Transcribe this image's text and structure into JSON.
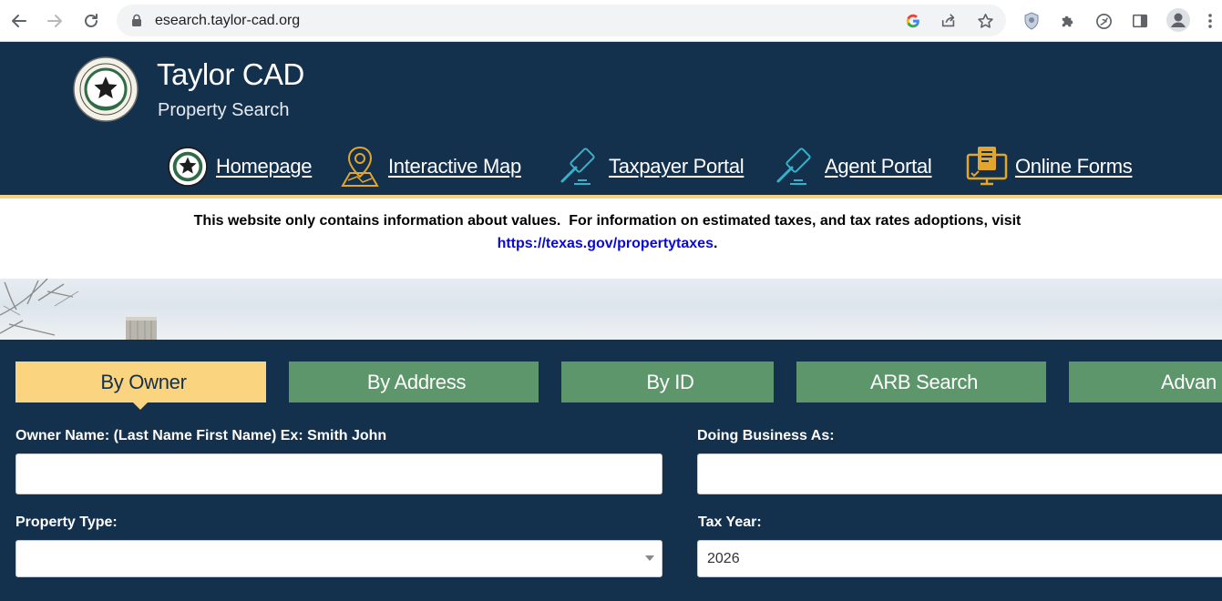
{
  "browser": {
    "url": "esearch.taylor-cad.org",
    "icons": [
      "back-icon",
      "forward-icon",
      "reload-icon",
      "lock-icon",
      "google-icon",
      "share-icon",
      "bookmark-star-icon",
      "shield-extension-icon",
      "puzzle-extensions-icon",
      "leaf-icon",
      "side-panel-icon",
      "profile-avatar-icon",
      "more-menu-icon"
    ]
  },
  "header": {
    "title": "Taylor CAD",
    "subtitle": "Property Search",
    "nav": [
      {
        "label": "Homepage",
        "icon": "star-seal-icon"
      },
      {
        "label": "Interactive Map",
        "icon": "map-pin-icon"
      },
      {
        "label": "Taxpayer Portal",
        "icon": "gavel-icon"
      },
      {
        "label": "Agent Portal",
        "icon": "gavel-icon"
      },
      {
        "label": "Online Forms",
        "icon": "computer-form-icon"
      }
    ],
    "colors": {
      "background": "#13304d",
      "accent": "#f3d384",
      "icon_teal": "#3ab0c8",
      "icon_gold": "#e3a62c"
    }
  },
  "notice": {
    "text": "This website only contains information about values.  For information on estimated taxes, and tax rates adoptions, visit",
    "link_text": "https://texas.gov/propertytaxes",
    "trailing": "."
  },
  "search": {
    "tabs": [
      {
        "label": "By Owner",
        "glyph": "",
        "active": true
      },
      {
        "label": "By Address",
        "glyph": "",
        "active": false
      },
      {
        "label": "By ID",
        "glyph": "",
        "active": false
      },
      {
        "label": "ARB Search",
        "glyph": "",
        "active": false
      },
      {
        "label": "Advan",
        "glyph": "",
        "active": false
      }
    ],
    "fields": {
      "owner_name": {
        "label": "Owner Name: (Last Name First Name) Ex: Smith John",
        "value": ""
      },
      "dba": {
        "label": "Doing Business As:",
        "value": ""
      },
      "property_type": {
        "label": "Property Type:",
        "value": ""
      },
      "tax_year": {
        "label": "Tax Year:",
        "value": "2026"
      }
    },
    "colors": {
      "active_tab": "#fad47f",
      "inactive_tab": "#5d966a"
    }
  }
}
